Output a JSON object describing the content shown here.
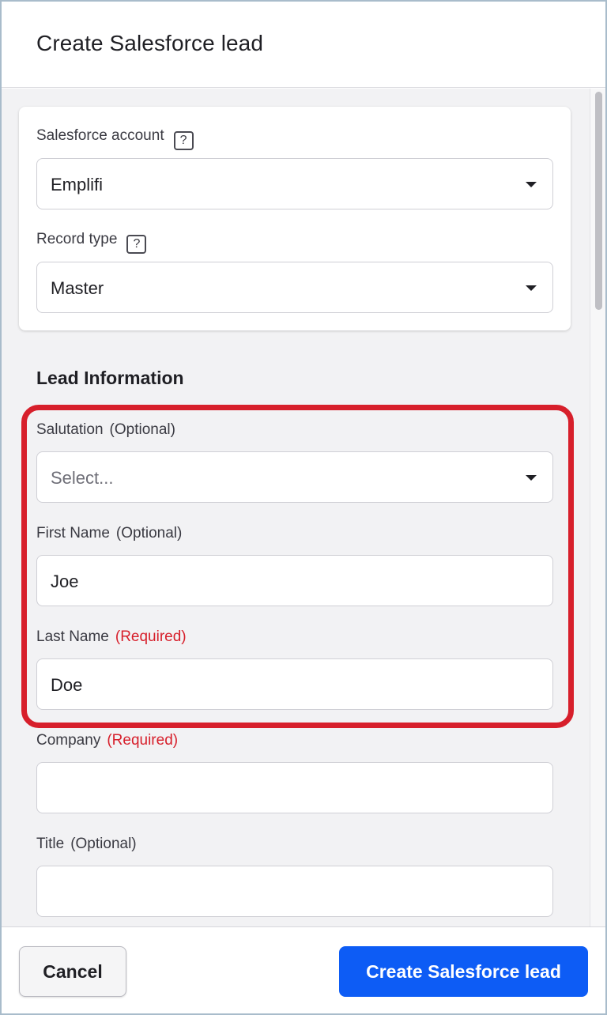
{
  "dialog": {
    "title": "Create Salesforce lead"
  },
  "settings": {
    "account": {
      "label": "Salesforce account",
      "help_icon": "question-mark-icon",
      "value": "Emplifi"
    },
    "record_type": {
      "label": "Record type",
      "help_icon": "question-mark-icon",
      "value": "Master"
    }
  },
  "lead_information": {
    "title": "Lead Information",
    "salutation": {
      "label": "Salutation",
      "tag": "(Optional)",
      "placeholder": "Select..."
    },
    "first_name": {
      "label": "First Name",
      "tag": "(Optional)",
      "value": "Joe"
    },
    "last_name": {
      "label": "Last Name",
      "tag": "(Required)",
      "value": "Doe"
    },
    "company": {
      "label": "Company",
      "tag": "(Required)",
      "value": ""
    },
    "title_field": {
      "label": "Title",
      "tag": "(Optional)",
      "value": ""
    }
  },
  "footer": {
    "cancel_label": "Cancel",
    "submit_label": "Create Salesforce lead"
  },
  "colors": {
    "primary": "#0d5cf5",
    "required": "#d71f2b",
    "highlight": "#d71f2b"
  }
}
